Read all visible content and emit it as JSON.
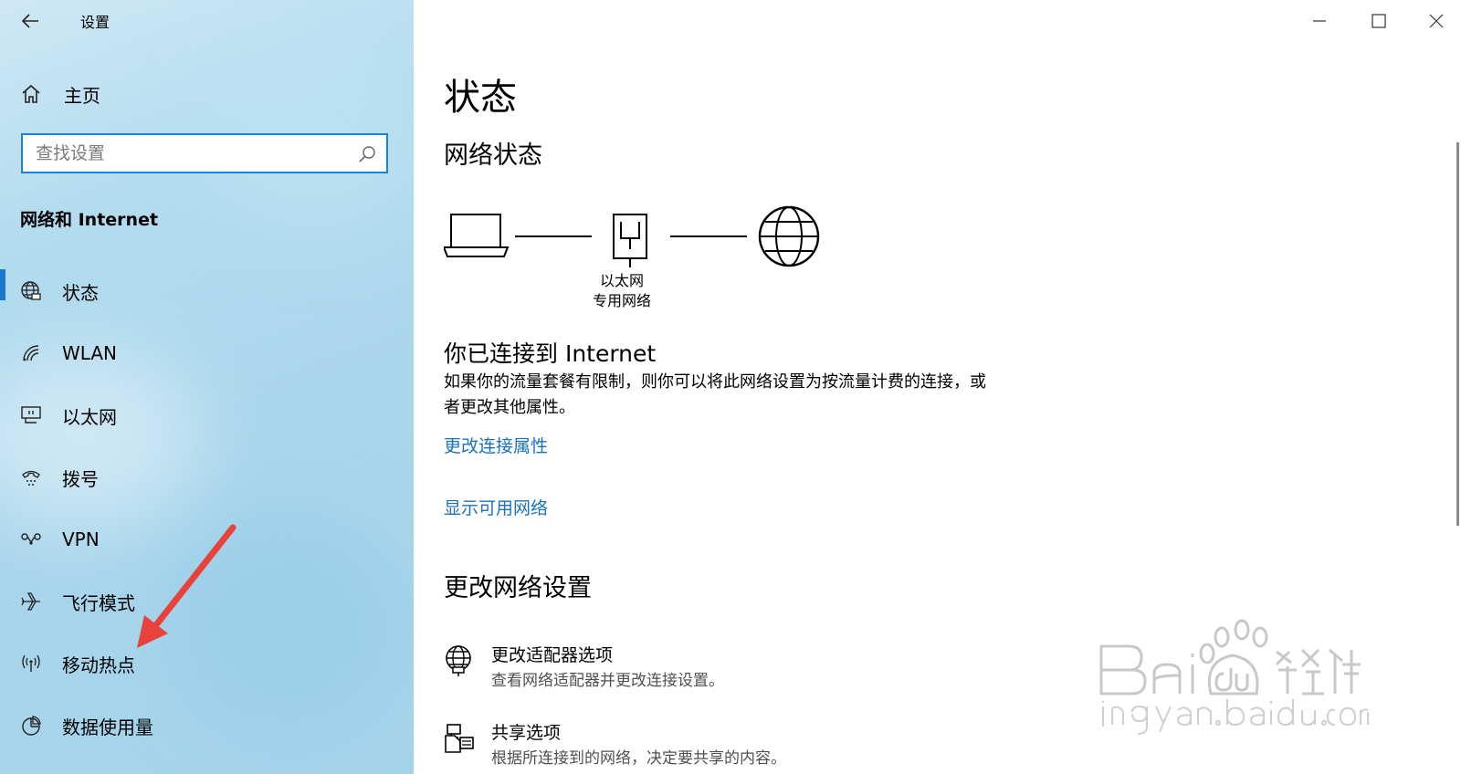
{
  "window": {
    "title": "设置",
    "controls": [
      "minimize-icon",
      "maximize-icon",
      "close-icon"
    ]
  },
  "sidebar": {
    "home_label": "主页",
    "search_placeholder": "查找设置",
    "section_title": "网络和 Internet",
    "items": [
      {
        "label": "状态",
        "icon": "network-status-icon",
        "active": true
      },
      {
        "label": "WLAN",
        "icon": "wifi-icon",
        "active": false
      },
      {
        "label": "以太网",
        "icon": "ethernet-icon",
        "active": false
      },
      {
        "label": "拨号",
        "icon": "dialup-icon",
        "active": false
      },
      {
        "label": "VPN",
        "icon": "vpn-icon",
        "active": false
      },
      {
        "label": "飞行模式",
        "icon": "airplane-icon",
        "active": false
      },
      {
        "label": "移动热点",
        "icon": "hotspot-icon",
        "active": false
      },
      {
        "label": "数据使用量",
        "icon": "data-usage-icon",
        "active": false
      }
    ]
  },
  "main": {
    "page_title": "状态",
    "network_status_heading": "网络状态",
    "diagram": {
      "adapter_name": "以太网",
      "network_type": "专用网络"
    },
    "connected_title": "你已连接到 Internet",
    "connected_desc": "如果你的流量套餐有限制，则你可以将此网络设置为按流量计费的连接，或者更改其他属性。",
    "links": {
      "change_properties": "更改连接属性",
      "show_networks": "显示可用网络"
    },
    "change_settings_heading": "更改网络设置",
    "settings": [
      {
        "title": "更改适配器选项",
        "subtitle": "查看网络适配器并更改连接设置。",
        "icon": "adapter-icon"
      },
      {
        "title": "共享选项",
        "subtitle": "根据所连接到的网络，决定要共享的内容。",
        "icon": "sharing-icon"
      }
    ]
  },
  "colors": {
    "accent": "#1a76c9",
    "link": "#1a72bf",
    "sidebar_bg": "#aad6ec",
    "annotation_arrow": "#e8423a"
  }
}
